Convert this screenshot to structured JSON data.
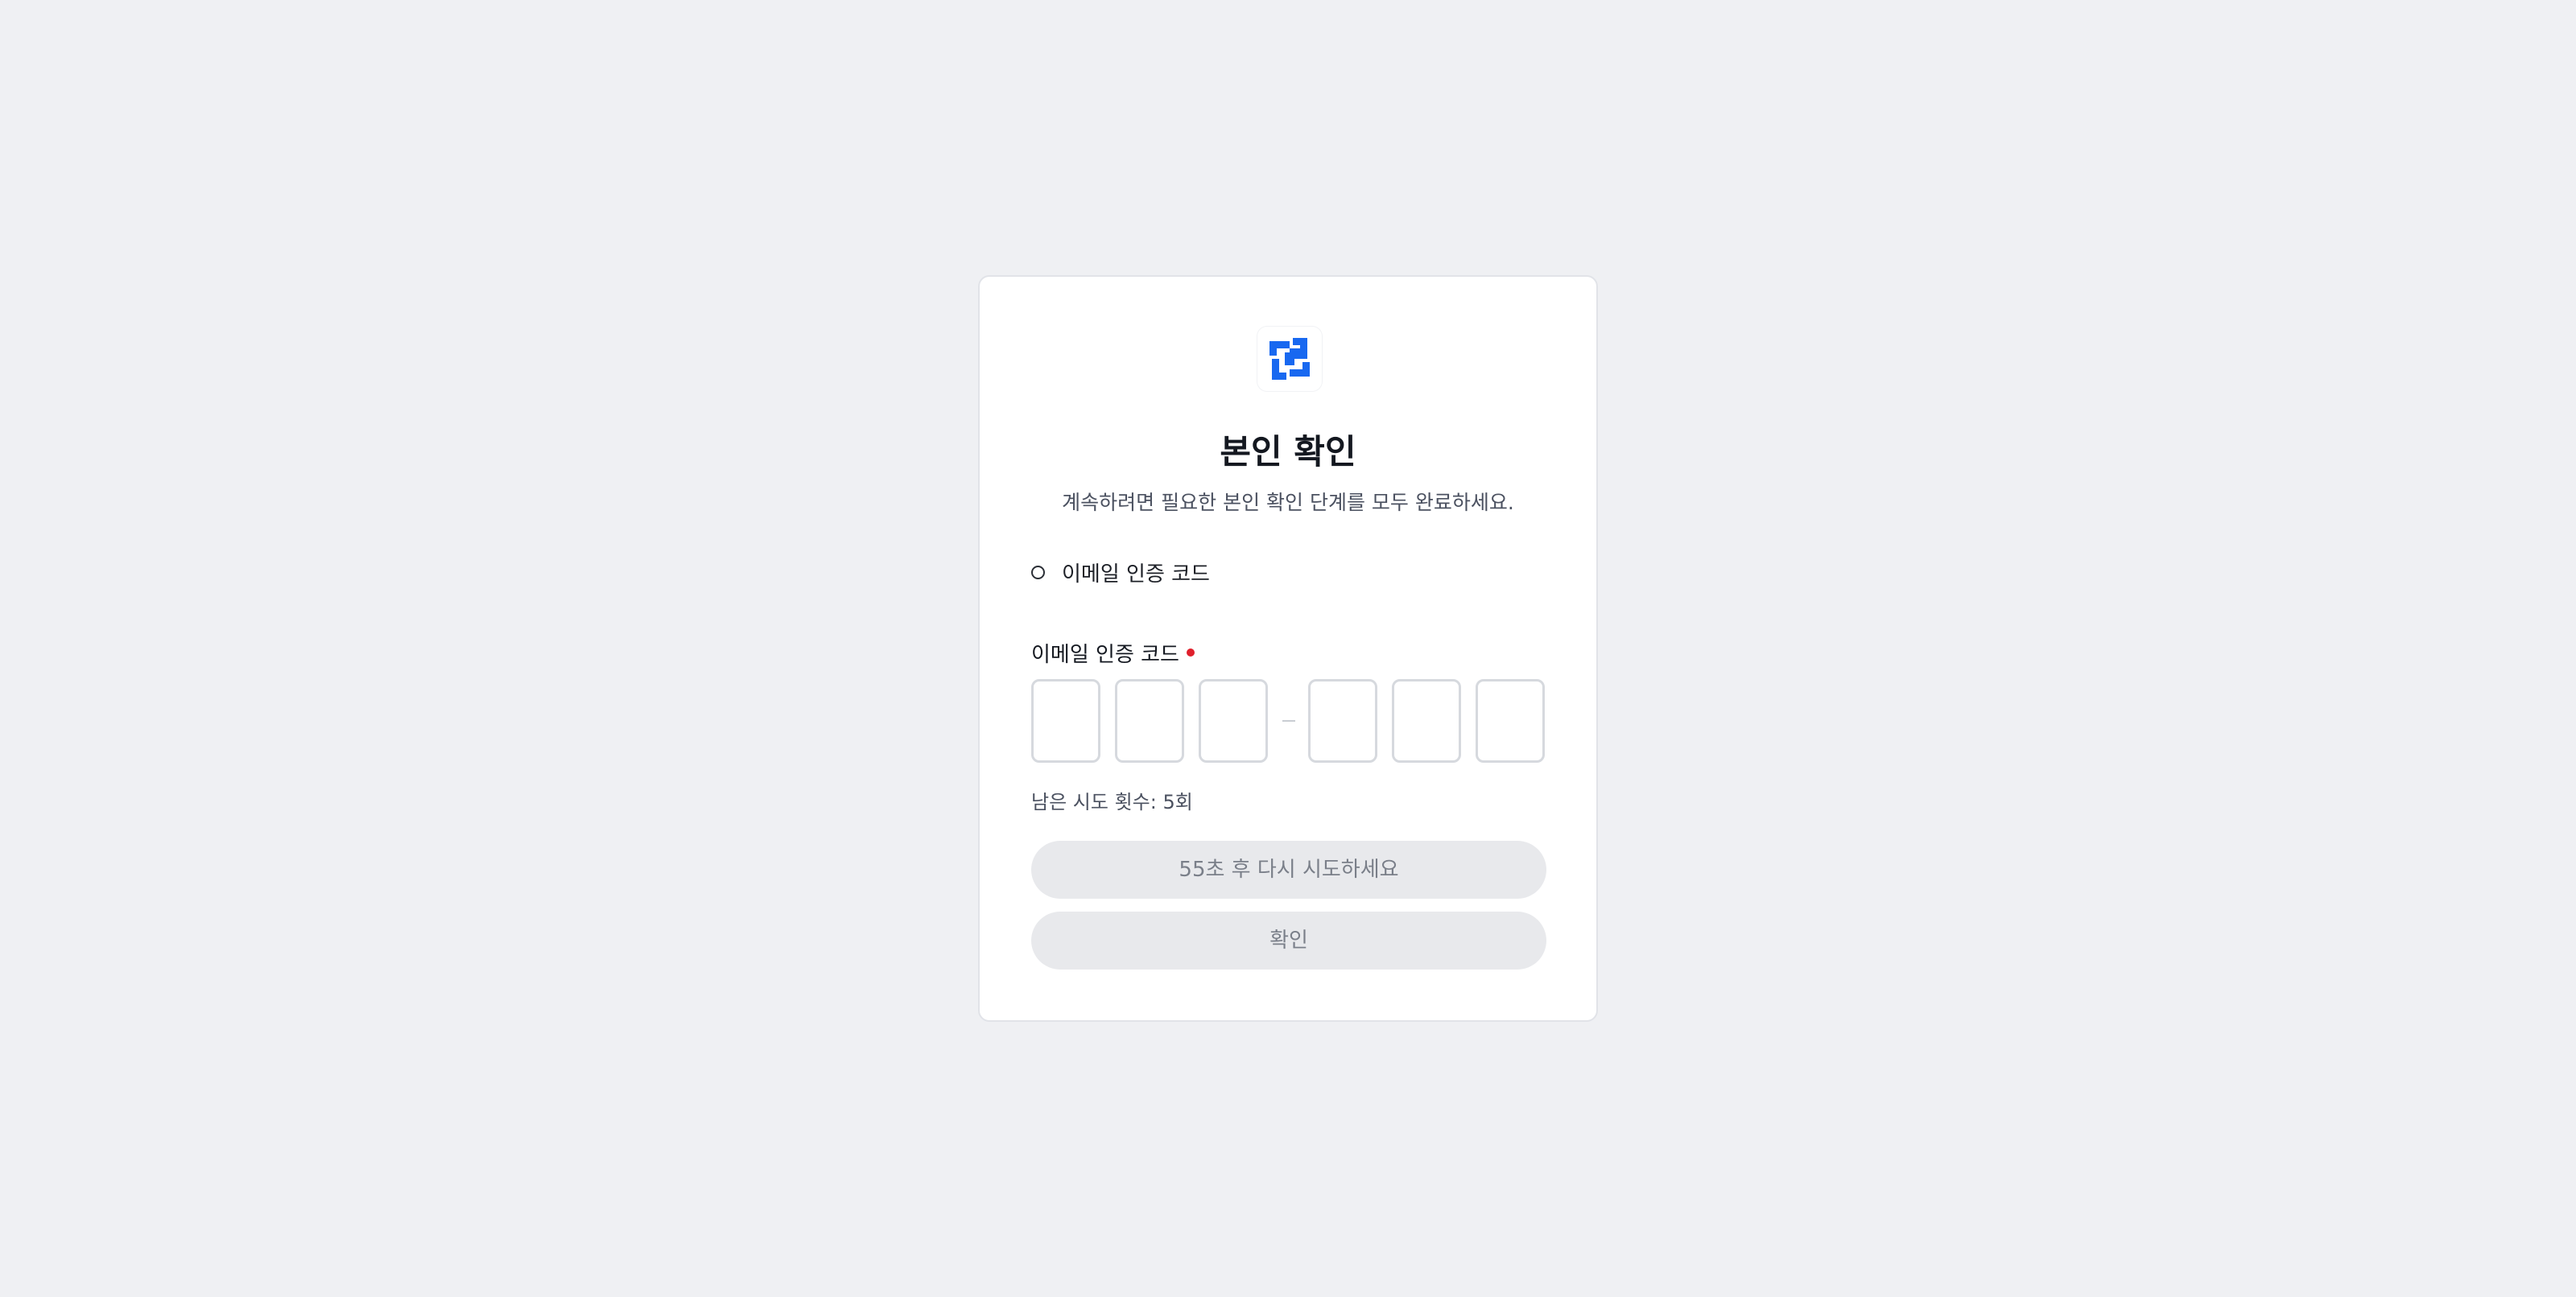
{
  "header": {
    "logo_icon": "brand-logo-icon",
    "title": "본인 확인",
    "subtitle": "계속하려면 필요한 본인 확인 단계를 모두 완료하세요."
  },
  "method": {
    "icon": "radio-circle-icon",
    "label": "이메일 인증 코드"
  },
  "code_field": {
    "label": "이메일 인증 코드",
    "required": true,
    "digits": [
      "",
      "",
      "",
      "",
      "",
      ""
    ],
    "attempts_text": "남은 시도 횟수: 5회"
  },
  "buttons": {
    "resend_label": "55초 후 다시 시도하세요",
    "confirm_label": "확인"
  },
  "colors": {
    "background": "#eff0f3",
    "brand": "#1868f0",
    "required": "#e0202c",
    "disabled_button": "#e8e9ec"
  }
}
